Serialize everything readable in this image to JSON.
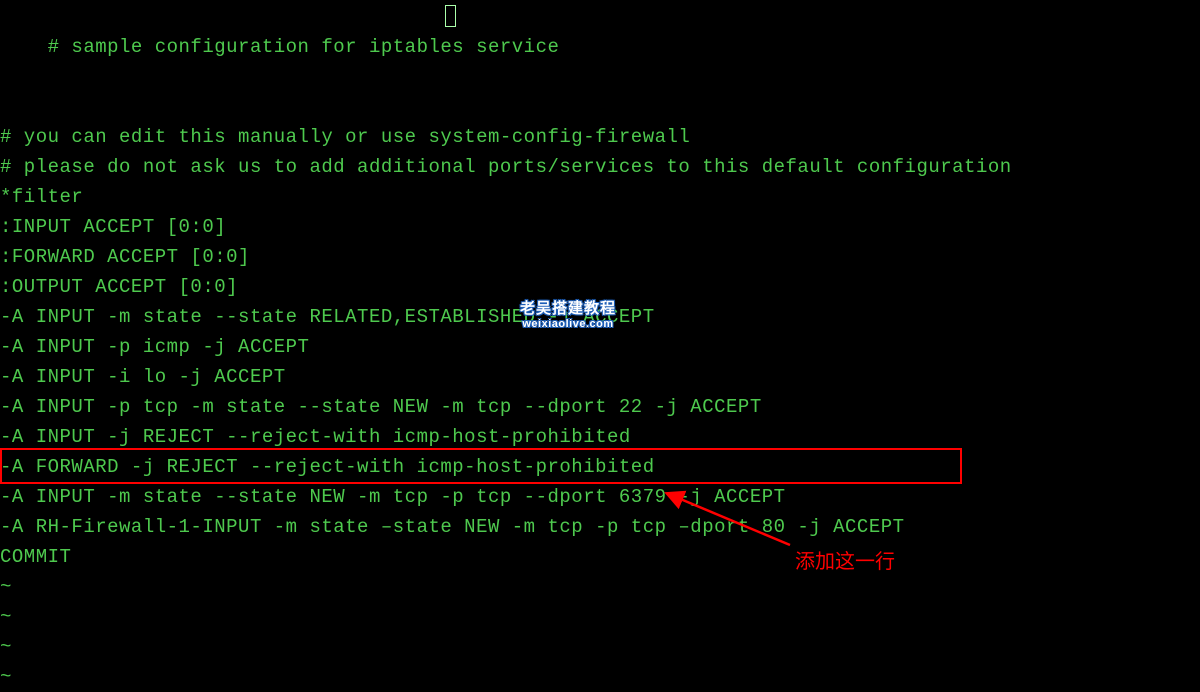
{
  "terminal": {
    "lines": [
      "# sample configuration for iptables service",
      "# you can edit this manually or use system-config-firewall",
      "# please do not ask us to add additional ports/services to this default configuration",
      "*filter",
      ":INPUT ACCEPT [0:0]",
      ":FORWARD ACCEPT [0:0]",
      ":OUTPUT ACCEPT [0:0]",
      "-A INPUT -m state --state RELATED,ESTABLISHED -j ACCEPT",
      "-A INPUT -p icmp -j ACCEPT",
      "-A INPUT -i lo -j ACCEPT",
      "-A INPUT -p tcp -m state --state NEW -m tcp --dport 22 -j ACCEPT",
      "-A INPUT -j REJECT --reject-with icmp-host-prohibited",
      "-A FORWARD -j REJECT --reject-with icmp-host-prohibited",
      "-A INPUT -m state --state NEW -m tcp -p tcp --dport 6379 -j ACCEPT",
      "-A RH-Firewall-1-INPUT -m state –state NEW -m tcp -p tcp –dport 80 -j ACCEPT",
      "COMMIT"
    ],
    "tildes": [
      "~",
      "~",
      "~",
      "~"
    ]
  },
  "annotation": {
    "text": "添加这一行"
  },
  "watermark": {
    "line1": "老吴搭建教程",
    "line2": "weixiaolive.com"
  }
}
